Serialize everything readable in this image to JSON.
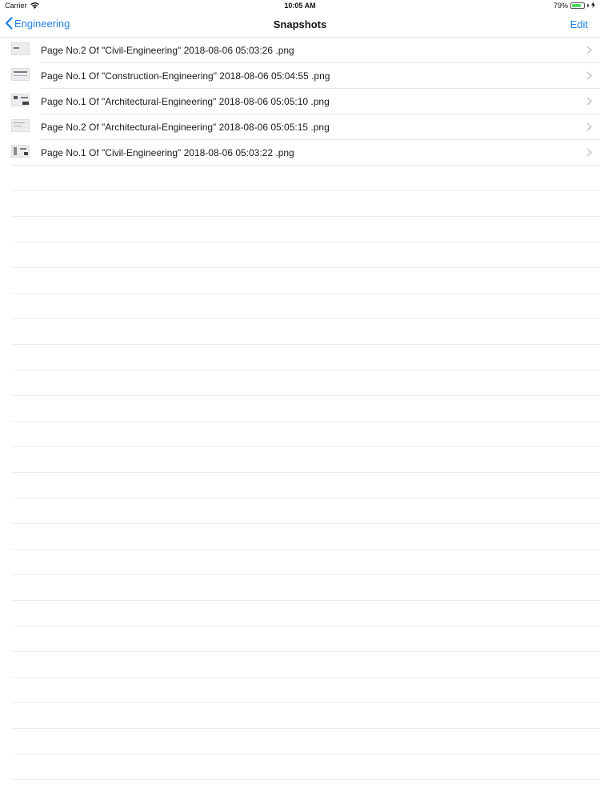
{
  "status_bar": {
    "carrier": "Carrier",
    "time": "10:05 AM",
    "battery_percent": "79%",
    "battery_level": 0.79,
    "icons": [
      "wifi-icon",
      "battery-icon",
      "charging-icon"
    ],
    "battery_color": "#4cd964"
  },
  "nav": {
    "back_label": "Engineering",
    "title": "Snapshots",
    "edit_label": "Edit",
    "accent_color": "#1f7fe0",
    "back_icon": "chevron-left-icon"
  },
  "snapshots": {
    "items": [
      {
        "label": "Page No.2 Of \"Civil-Engineering\" 2018-08-06 05:03:26 .png",
        "thumb": "thumbnail-icon"
      },
      {
        "label": "Page No.1 Of \"Construction-Engineering\" 2018-08-06 05:04:55 .png",
        "thumb": "thumbnail-icon"
      },
      {
        "label": "Page No.1 Of \"Architectural-Engineering\" 2018-08-06 05:05:10 .png",
        "thumb": "thumbnail-icon"
      },
      {
        "label": "Page No.2 Of \"Architectural-Engineering\" 2018-08-06 05:05:15 .png",
        "thumb": "thumbnail-icon"
      },
      {
        "label": "Page No.1 Of \"Civil-Engineering\" 2018-08-06 05:03:22 .png",
        "thumb": "thumbnail-icon"
      }
    ],
    "row_icon": "chevron-right-icon"
  }
}
